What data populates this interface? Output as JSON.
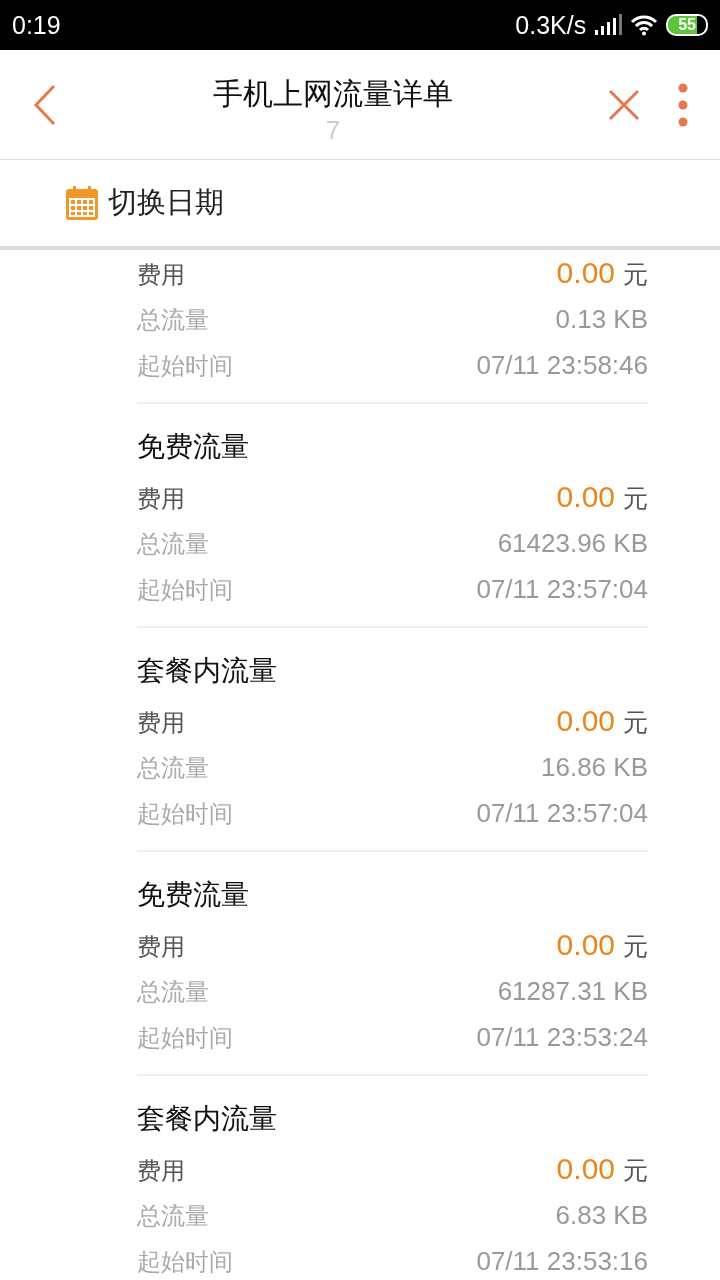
{
  "status_bar": {
    "time": "0:19",
    "network_speed": "0.3K/s",
    "battery": "55"
  },
  "header": {
    "title": "手机上网流量详单",
    "subtitle": "7"
  },
  "date_switch": {
    "label": "切换日期"
  },
  "records": [
    {
      "fee_label": "费用",
      "fee": "0.00",
      "unit": "元",
      "total_label": "总流量",
      "total": "0.13 KB",
      "start_label": "起始时间",
      "start": "07/11 23:58:46"
    },
    {
      "title": "免费流量",
      "fee_label": "费用",
      "fee": "0.00",
      "unit": "元",
      "total_label": "总流量",
      "total": "61423.96 KB",
      "start_label": "起始时间",
      "start": "07/11 23:57:04"
    },
    {
      "title": "套餐内流量",
      "fee_label": "费用",
      "fee": "0.00",
      "unit": "元",
      "total_label": "总流量",
      "total": "16.86 KB",
      "start_label": "起始时间",
      "start": "07/11 23:57:04"
    },
    {
      "title": "免费流量",
      "fee_label": "费用",
      "fee": "0.00",
      "unit": "元",
      "total_label": "总流量",
      "total": "61287.31 KB",
      "start_label": "起始时间",
      "start": "07/11 23:53:24"
    },
    {
      "title": "套餐内流量",
      "fee_label": "费用",
      "fee": "0.00",
      "unit": "元",
      "total_label": "总流量",
      "total": "6.83 KB",
      "start_label": "起始时间",
      "start": "07/11 23:53:16"
    }
  ]
}
